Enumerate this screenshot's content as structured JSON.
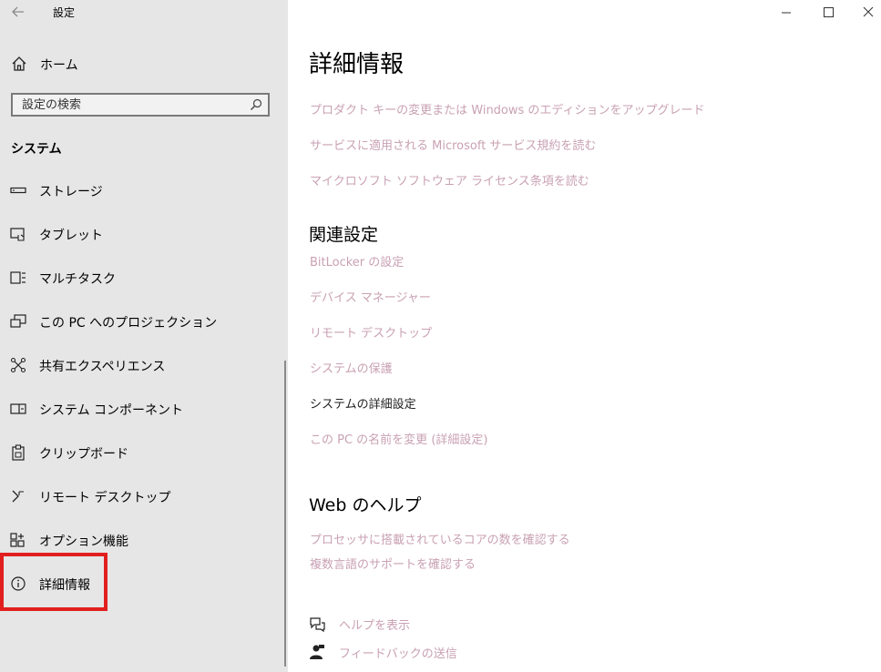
{
  "window": {
    "title": "設定",
    "controls": {
      "minimize_icon": "minimize-icon",
      "maximize_icon": "maximize-icon",
      "close_icon": "close-icon"
    }
  },
  "sidebar": {
    "back_icon": "back-arrow-icon",
    "home_label": "ホーム",
    "search_placeholder": "設定の検索",
    "section_title": "システム",
    "items": [
      {
        "label": "ストレージ",
        "icon": "storage-icon"
      },
      {
        "label": "タブレット",
        "icon": "tablet-icon"
      },
      {
        "label": "マルチタスク",
        "icon": "multitask-icon"
      },
      {
        "label": "この PC へのプロジェクション",
        "icon": "projection-icon"
      },
      {
        "label": "共有エクスペリエンス",
        "icon": "shared-experience-icon"
      },
      {
        "label": "システム コンポーネント",
        "icon": "components-icon"
      },
      {
        "label": "クリップボード",
        "icon": "clipboard-icon"
      },
      {
        "label": "リモート デスクトップ",
        "icon": "remote-desktop-icon"
      },
      {
        "label": "オプション機能",
        "icon": "optional-features-icon"
      },
      {
        "label": "詳細情報",
        "icon": "info-icon"
      }
    ]
  },
  "main": {
    "title": "詳細情報",
    "top_links": [
      "プロダクト キーの変更または Windows のエディションをアップグレード",
      "サービスに適用される Microsoft サービス規約を読む",
      "マイクロソフト ソフトウェア ライセンス条項を読む"
    ],
    "related_title": "関連設定",
    "related_links": [
      "BitLocker の設定",
      "デバイス マネージャー",
      "リモート デスクトップ",
      "システムの保護",
      "システムの詳細設定",
      "この PC の名前を変更 (詳細設定)"
    ],
    "web_help_title": "Web のヘルプ",
    "web_help_links": [
      "プロセッサに搭載されているコアの数を確認する",
      "複数言語のサポートを確認する"
    ],
    "help_label": "ヘルプを表示",
    "feedback_label": "フィードバックの送信"
  },
  "colors": {
    "sidebar_bg": "#e6e6e6",
    "link": "#c9a1b3",
    "highlight": "#e21f1f"
  }
}
